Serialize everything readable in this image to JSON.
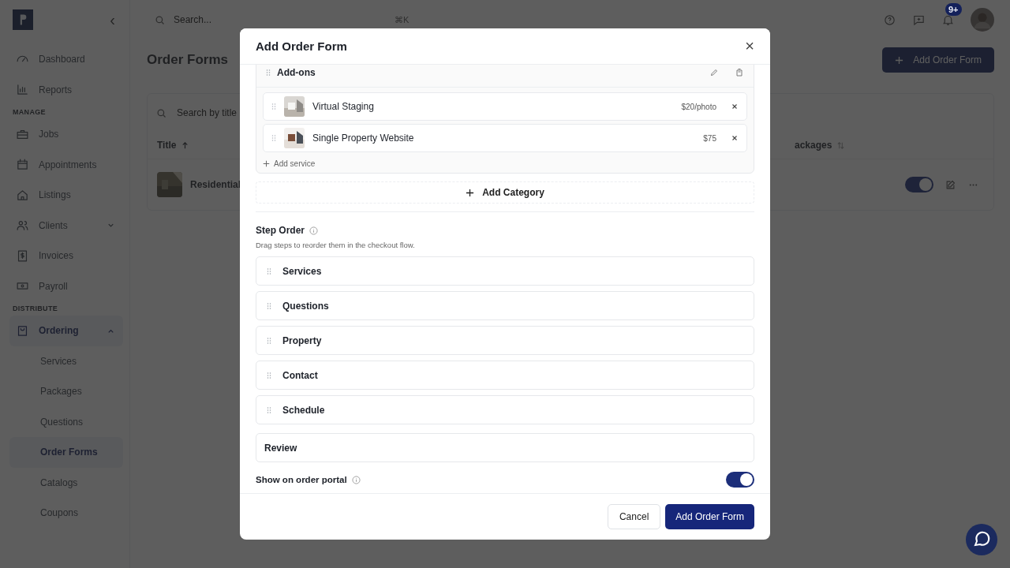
{
  "sidebar": {
    "collapse_glyph": "‹",
    "sections": [
      {
        "items": [
          {
            "label": "Dashboard",
            "selected": false
          },
          {
            "label": "Reports",
            "selected": false
          }
        ]
      },
      {
        "heading": "MANAGE",
        "items": [
          {
            "label": "Jobs",
            "selected": false
          },
          {
            "label": "Appointments",
            "selected": false
          },
          {
            "label": "Listings",
            "selected": false
          },
          {
            "label": "Clients",
            "selected": false,
            "expanded": false
          },
          {
            "label": "Invoices",
            "selected": false
          },
          {
            "label": "Payroll",
            "selected": false
          }
        ]
      },
      {
        "heading": "DISTRIBUTE",
        "items": [
          {
            "label": "Ordering",
            "selected": true,
            "expanded": true,
            "children": [
              {
                "label": "Services",
                "selected": false
              },
              {
                "label": "Packages",
                "selected": false
              },
              {
                "label": "Questions",
                "selected": false
              },
              {
                "label": "Order Forms",
                "selected": true
              },
              {
                "label": "Catalogs",
                "selected": false
              },
              {
                "label": "Coupons",
                "selected": false
              }
            ]
          }
        ]
      }
    ]
  },
  "topbar": {
    "search": {
      "placeholder": "Search..."
    },
    "shortcut": "⌘K",
    "notification_badge": "9+"
  },
  "page": {
    "title": "Order Forms",
    "add_button": "Add Order Form",
    "table_search": {
      "placeholder": "Search by title"
    },
    "columns": [
      {
        "label": "Title",
        "sorted": true
      },
      {
        "label": "ackages",
        "sorted": false
      }
    ],
    "rows": [
      {
        "title": "Residential",
        "enabled": true
      }
    ]
  },
  "modal": {
    "title": "Add Order Form",
    "close_glyph": "×",
    "category": {
      "name": "Add-ons",
      "services": [
        {
          "name": "Virtual Staging",
          "price": "$20/photo"
        },
        {
          "name": "Single Property Website",
          "price": "$75"
        }
      ],
      "add_service": "Add service"
    },
    "add_category": "Add Category",
    "step_order": {
      "label": "Step Order",
      "hint": "Drag steps to reorder them in the checkout flow.",
      "steps": [
        {
          "label": "Services",
          "kind": "draggable"
        },
        {
          "label": "Questions",
          "kind": "draggable"
        },
        {
          "label": "Property",
          "kind": "draggable"
        },
        {
          "label": "Contact",
          "kind": "draggable"
        },
        {
          "label": "Schedule",
          "kind": "draggable"
        },
        {
          "label": "Review",
          "kind": "fixed"
        }
      ]
    },
    "portal_toggle": {
      "label": "Show on order portal",
      "on": true
    },
    "buttons": {
      "cancel": "Cancel",
      "submit": "Add Order Form"
    }
  }
}
